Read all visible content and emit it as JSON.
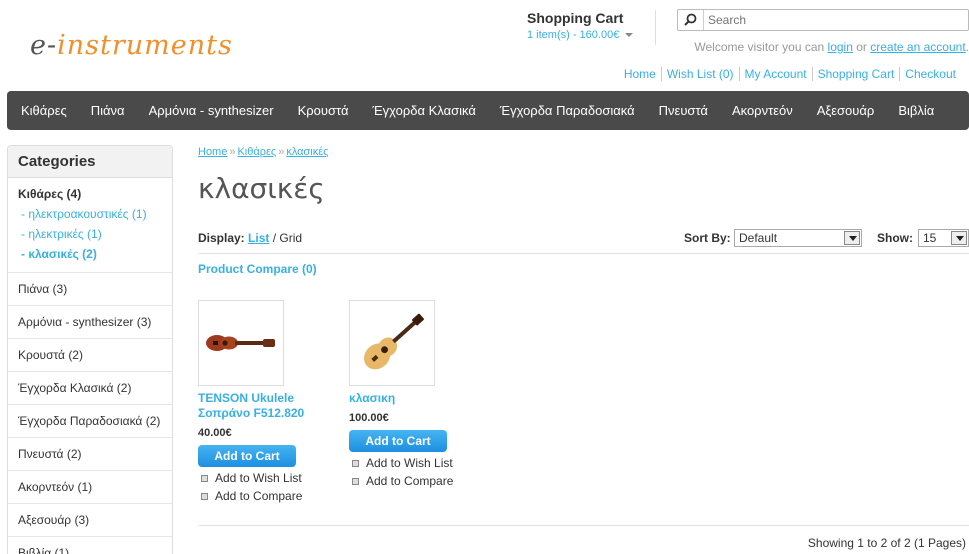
{
  "logo": {
    "text_part1": "e-",
    "text_part2": "instruments"
  },
  "cart": {
    "title": "Shopping Cart",
    "summary": "1 item(s) - 160.00€"
  },
  "search": {
    "placeholder": "Search"
  },
  "welcome": {
    "prefix": "Welcome visitor you can ",
    "login": "login",
    "or": " or ",
    "create": "create an account",
    "suffix": "."
  },
  "top_links": [
    "Home",
    "Wish List (0)",
    "My Account",
    "Shopping Cart",
    "Checkout"
  ],
  "menu": [
    "Κιθάρες",
    "Πιάνα",
    "Αρμόνια - synthesizer",
    "Κρουστά",
    "Έγχορδα Κλασικά",
    "Έγχορδα Παραδοσιακά",
    "Πνευστά",
    "Ακορντεόν",
    "Αξεσουάρ",
    "Βιβλία"
  ],
  "sidebar": {
    "title": "Categories",
    "active_category": "Κιθάρες (4)",
    "subcategories": [
      {
        "label": "- ηλεκτροακουστικές (1)",
        "active": false
      },
      {
        "label": "- ηλεκτρικές (1)",
        "active": false
      },
      {
        "label": "- κλασικές (2)",
        "active": true
      }
    ],
    "categories": [
      "Πιάνα (3)",
      "Αρμόνια - synthesizer (3)",
      "Κρουστά (2)",
      "Έγχορδα Κλασικά (2)",
      "Έγχορδα Παραδοσιακά (2)",
      "Πνευστά (2)",
      "Ακορντεόν (1)",
      "Αξεσουάρ (3)",
      "Βιβλία (1)"
    ]
  },
  "breadcrumb": [
    "Home",
    "Κιθάρες",
    "κλασικές"
  ],
  "breadcrumb_sep": "»",
  "page_title": "κλασικές",
  "display": {
    "label": "Display:",
    "list": "List",
    "sep": " / ",
    "grid": "Grid"
  },
  "sort": {
    "label": "Sort By:",
    "value": "Default"
  },
  "show": {
    "label": "Show:",
    "value": "15"
  },
  "compare_link": "Product Compare (0)",
  "products": [
    {
      "name": "TENSON Ukulele Σοπράνο F512.820",
      "price": "40.00€",
      "add_to_cart": "Add to Cart",
      "wish": "Add to Wish List",
      "compare": "Add to Compare"
    },
    {
      "name": "κλασικη",
      "price": "100.00€",
      "add_to_cart": "Add to Cart",
      "wish": "Add to Wish List",
      "compare": "Add to Compare"
    }
  ],
  "pagination": "Showing 1 to 2 of 2 (1 Pages)"
}
